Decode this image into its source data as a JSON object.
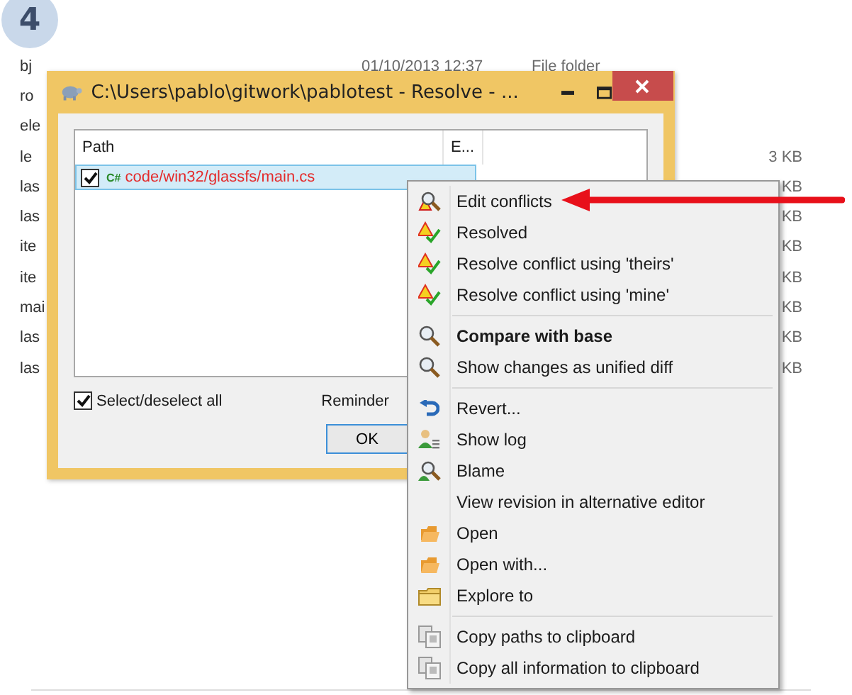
{
  "step_badge": "4",
  "background_list": {
    "rows": [
      {
        "name": "bj",
        "date": "01/10/2013 12:37",
        "type": "File folder"
      },
      {
        "name": "ro"
      },
      {
        "name": "ele"
      },
      {
        "name": "le",
        "size": "3 KB"
      },
      {
        "name": "las",
        "size": "KB"
      },
      {
        "name": "las",
        "size": "KB"
      },
      {
        "name": "ite",
        "size": "KB"
      },
      {
        "name": "ite",
        "size": "KB"
      },
      {
        "name": "mai",
        "size": "KB"
      },
      {
        "name": "las",
        "size": "KB"
      },
      {
        "name": "las",
        "size": "KB"
      }
    ]
  },
  "dialog": {
    "title": "C:\\Users\\pablo\\gitwork\\pablotest - Resolve - ...",
    "columns": [
      "Path",
      "E..."
    ],
    "rows": [
      {
        "checked": true,
        "selected": true,
        "type_icon": "C#",
        "path": "code/win32/glassfs/main.cs"
      }
    ],
    "select_all": {
      "label": "Select/deselect all",
      "checked": true
    },
    "reminder": "Reminder",
    "ok_button": "OK"
  },
  "context_menu": [
    {
      "kind": "item",
      "label": "Edit conflicts",
      "bold": false
    },
    {
      "kind": "item",
      "label": "Resolved",
      "bold": false
    },
    {
      "kind": "item",
      "label": "Resolve conflict using 'theirs'",
      "bold": false
    },
    {
      "kind": "item",
      "label": "Resolve conflict using 'mine'",
      "bold": false
    },
    {
      "kind": "separator"
    },
    {
      "kind": "item",
      "label": "Compare with base",
      "bold": true
    },
    {
      "kind": "item",
      "label": "Show changes as unified diff",
      "bold": false
    },
    {
      "kind": "separator"
    },
    {
      "kind": "item",
      "label": "Revert...",
      "bold": false
    },
    {
      "kind": "item",
      "label": "Show log",
      "bold": false
    },
    {
      "kind": "item",
      "label": "Blame",
      "bold": false
    },
    {
      "kind": "item",
      "label": "View revision in alternative editor",
      "bold": false
    },
    {
      "kind": "item",
      "label": "Open",
      "bold": false
    },
    {
      "kind": "item",
      "label": "Open with...",
      "bold": false
    },
    {
      "kind": "item",
      "label": "Explore to",
      "bold": false
    },
    {
      "kind": "separator"
    },
    {
      "kind": "item",
      "label": "Copy paths to clipboard",
      "bold": false
    },
    {
      "kind": "item",
      "label": "Copy all information to clipboard",
      "bold": false
    }
  ]
}
